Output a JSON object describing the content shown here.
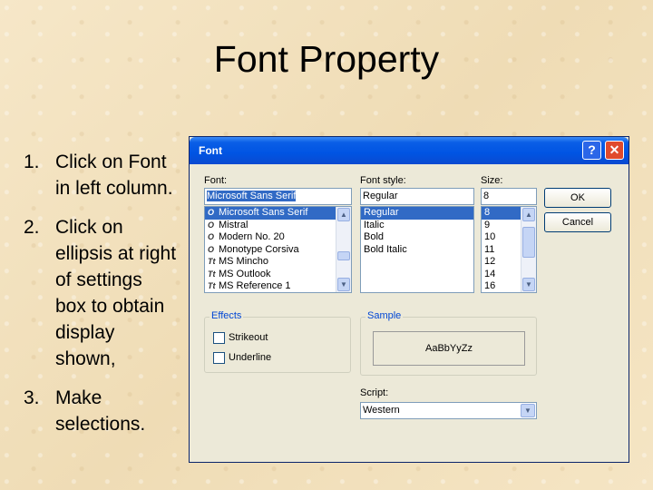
{
  "slide": {
    "title": "Font Property",
    "steps": [
      {
        "num": "1.",
        "text": "Click on Font in left column."
      },
      {
        "num": "2.",
        "text": "Click on ellipsis at right of settings box to obtain display shown,"
      },
      {
        "num": "3.",
        "text": "Make selections."
      }
    ]
  },
  "dialog": {
    "title": "Font",
    "help_glyph": "?",
    "close_glyph": "✕",
    "font_label": "Font:",
    "font_value": "Microsoft Sans Serif",
    "font_list": [
      {
        "icon": "O",
        "icon_name": "opentype-font-icon",
        "label": "Microsoft Sans Serif",
        "selected": true
      },
      {
        "icon": "O",
        "icon_name": "opentype-font-icon",
        "label": "Mistral"
      },
      {
        "icon": "O",
        "icon_name": "opentype-font-icon",
        "label": "Modern No. 20"
      },
      {
        "icon": "O",
        "icon_name": "opentype-font-icon",
        "label": "Monotype Corsiva"
      },
      {
        "icon": "Tt",
        "icon_name": "truetype-font-icon",
        "label": "MS Mincho"
      },
      {
        "icon": "Tt",
        "icon_name": "truetype-font-icon",
        "label": "MS Outlook"
      },
      {
        "icon": "Tt",
        "icon_name": "truetype-font-icon",
        "label": "MS Reference 1"
      }
    ],
    "style_label": "Font style:",
    "style_value": "Regular",
    "style_list": [
      {
        "label": "Regular",
        "selected": true
      },
      {
        "label": "Italic"
      },
      {
        "label": "Bold"
      },
      {
        "label": "Bold Italic"
      }
    ],
    "size_label": "Size:",
    "size_value": "8",
    "size_list": [
      {
        "label": "8",
        "selected": true
      },
      {
        "label": "9"
      },
      {
        "label": "10"
      },
      {
        "label": "11"
      },
      {
        "label": "12"
      },
      {
        "label": "14"
      },
      {
        "label": "16"
      }
    ],
    "ok_label": "OK",
    "cancel_label": "Cancel",
    "effects_label": "Effects",
    "strikeout_label": "Strikeout",
    "underline_label": "Underline",
    "sample_label": "Sample",
    "sample_text": "AaBbYyZz",
    "script_label": "Script:",
    "script_value": "Western",
    "scroll_up_glyph": "▲",
    "scroll_down_glyph": "▼",
    "colors": {
      "titlebar": "#0054e3",
      "selection": "#316ac5",
      "close": "#e04a2c",
      "group_title": "#0046d5"
    }
  }
}
